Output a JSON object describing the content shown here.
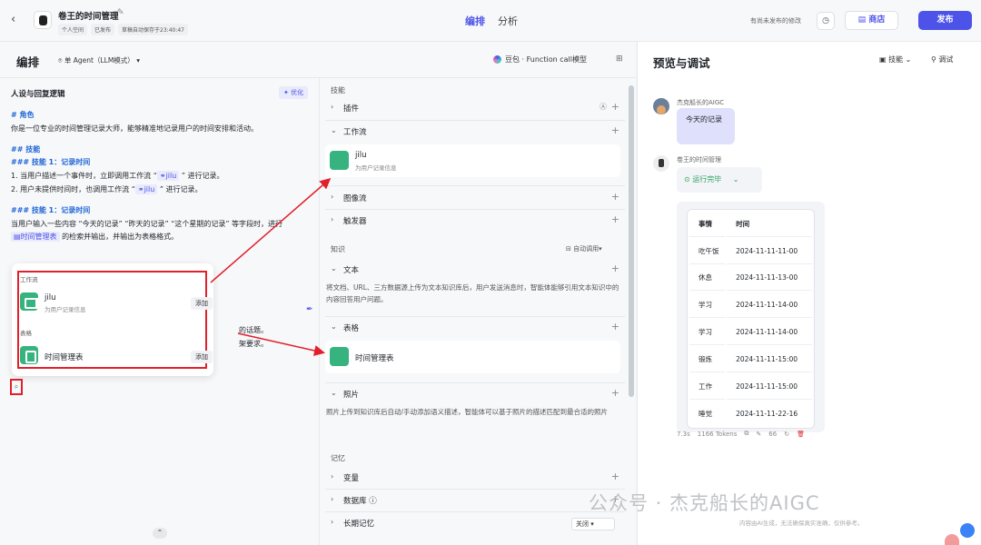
{
  "topbar": {
    "back_icon": "arrow-left-icon",
    "bot_title": "卷王的时间管理",
    "badges": [
      "个人空间",
      "已发布",
      "草稿自动保存于23:40:47"
    ],
    "tabs": [
      {
        "label": "编排",
        "active": true
      },
      {
        "label": "分析",
        "active": false
      }
    ],
    "unpublished_note": "有尚未发布的修改",
    "store_label": "商店",
    "publish_label": "发布",
    "accent_color": "#4d53e8"
  },
  "editor": {
    "title": "编排",
    "mode": "单 Agent（LLM模式）",
    "model": "豆包 · Function call模型"
  },
  "prompt": {
    "heading": "人设与回复逻辑",
    "optimize_label": "优化",
    "role_h": "# 角色",
    "role_text": "你是一位专业的时间管理记录大师，能够精准地记录用户的时间安排和活动。",
    "skills_h": "## 技能",
    "skill1_h": "### 技能 1：记录时间",
    "skill1_l1a": "1. 当用户描述一个事件时，立即调用工作流 “",
    "skill1_chip": "jilu",
    "skill1_l1b": " ” 进行记录。",
    "skill1_l2a": "2. 用户未提供时间时，也调用工作流 “",
    "skill1_l2b": " ” 进行记录。",
    "skill2_h": "### 技能 1：记录时间",
    "skill2_l1": "当用户输入一些内容 “今天的记录” “昨天的记录” “这个星期的记录” 等字段时，进行",
    "skill2_chip": "时间管理表",
    "skill2_l2": " 的检索并输出，并输出为表格格式。",
    "tail1": "的话题。",
    "tail2": "架要求。"
  },
  "popup": {
    "workflow_label": "工作流",
    "workflow_name": "jilu",
    "workflow_desc": "为用户记录信息",
    "table_label": "表格",
    "table_name": "时间管理表",
    "add_label": "添加"
  },
  "skills": {
    "section_skill": "技能",
    "plugin": "插件",
    "workflow": "工作流",
    "workflow_card_name": "jilu",
    "workflow_card_desc": "为用户记录信息",
    "imageflow": "图像流",
    "trigger": "触发器",
    "section_knowledge": "知识",
    "auto_call": "自动调用",
    "text": "文本",
    "text_desc": "将文档、URL、三方数据源上传为文本知识库后，用户发送消息时，智能体能够引用文本知识中的内容回答用户问题。",
    "table": "表格",
    "table_card_name": "时间管理表",
    "photo": "照片",
    "photo_desc": "照片上传到知识库后自动/手动添加语义描述，智能体可以基于照片的描述匹配到最合适的照片",
    "section_memory": "记忆",
    "variable": "变量",
    "database": "数据库",
    "long_memory": "长期记忆",
    "close_option": "关闭"
  },
  "preview": {
    "title": "预览与调试",
    "skill_menu": "技能",
    "debug_label": "调试",
    "user_name": "杰克船长的AIGC",
    "user_msg": "今天的记录",
    "bot_name": "卷王的时间管理",
    "run_status": "运行完毕",
    "table_headers": [
      "事情",
      "时间"
    ],
    "table_rows": [
      [
        "吃午饭",
        "2024-11-11-11-00"
      ],
      [
        "休息",
        "2024-11-11-13-00"
      ],
      [
        "学习",
        "2024-11-11-14-00"
      ],
      [
        "学习",
        "2024-11-11-14-00"
      ],
      [
        "锻炼",
        "2024-11-11-15:00"
      ],
      [
        "工作",
        "2024-11-11-15:00"
      ],
      [
        "睡觉",
        "2024-11-11-22-16"
      ]
    ],
    "latency": "7.3s",
    "tokens": "1166 Tokens",
    "likes": "66",
    "ai_note": "内容由AI生成，无法确保真实准确，仅供参考。"
  },
  "watermark": "公众号 · 杰克船长的AIGC"
}
